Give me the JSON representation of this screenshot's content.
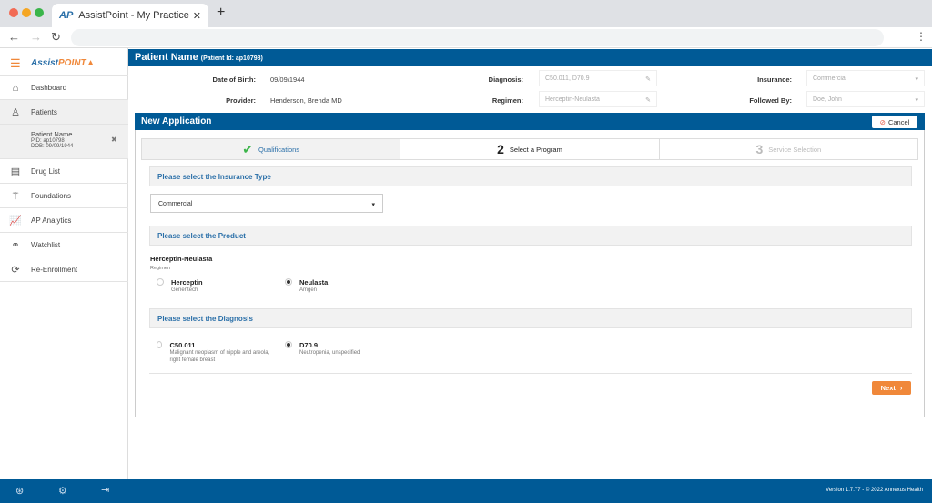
{
  "browser": {
    "tab_title": "AssistPoint - My Practice",
    "tab_logo": "AP"
  },
  "sidebar": {
    "logo_a": "Assist",
    "logo_b": "POINT",
    "items": [
      {
        "label": "Dashboard",
        "icon": "home-icon"
      },
      {
        "label": "Patients",
        "icon": "user-edit-icon"
      },
      {
        "label": "Drug List",
        "icon": "drug-list-icon"
      },
      {
        "label": "Foundations",
        "icon": "foundation-icon"
      },
      {
        "label": "AP Analytics",
        "icon": "analytics-icon"
      },
      {
        "label": "Watchlist",
        "icon": "binoculars-icon"
      },
      {
        "label": "Re-Enrollment",
        "icon": "refresh-icon"
      }
    ],
    "patient": {
      "name": "Patient Name",
      "pid": "PID: ap10798",
      "dob": "DOB: 09/09/1944"
    }
  },
  "header": {
    "title": "Patient Name",
    "patient_id": "(Patient Id: ap10798)"
  },
  "info": {
    "dob_label": "Date of Birth:",
    "dob": "09/09/1944",
    "provider_label": "Provider:",
    "provider": "Henderson, Brenda MD",
    "diagnosis_label": "Diagnosis:",
    "diagnosis": "C50.011, D70.9",
    "regimen_label": "Regimen:",
    "regimen": "Herceptin-Neulasta",
    "insurance_label": "Insurance:",
    "insurance": "Commercial",
    "followed_label": "Followed By:",
    "followed": "Doe, John"
  },
  "application": {
    "title": "New Application",
    "cancel": "Cancel",
    "steps": [
      {
        "num": "✔",
        "label": "Qualifications",
        "state": "done"
      },
      {
        "num": "2",
        "label": "Select a Program",
        "state": "active"
      },
      {
        "num": "3",
        "label": "Service Selection",
        "state": "pending"
      }
    ],
    "insurance_header": "Please select the Insurance Type",
    "insurance_value": "Commercial",
    "product_header": "Please select the Product",
    "regimen_name": "Herceptin-Neulasta",
    "regimen_caption": "Regimen",
    "products": [
      {
        "name": "Herceptin",
        "maker": "Genentech",
        "selected": false
      },
      {
        "name": "Neulasta",
        "maker": "Amgen",
        "selected": true
      }
    ],
    "diagnosis_header": "Please select the Diagnosis",
    "diagnoses": [
      {
        "code": "C50.011",
        "desc": "Malignant neoplasm of nipple and areola, right female breast",
        "selected": false
      },
      {
        "code": "D70.9",
        "desc": "Neutropenia, unspecified",
        "selected": true
      }
    ],
    "next": "Next"
  },
  "footer": {
    "version": "Version 1.7.77 - © 2022 Annexus Health"
  },
  "colors": {
    "brand": "#005a96",
    "accent": "#f0883a",
    "check": "#3cb54a"
  }
}
